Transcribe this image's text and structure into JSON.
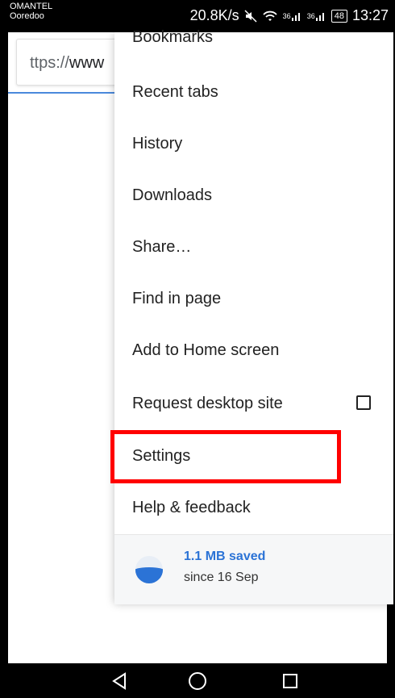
{
  "status_bar": {
    "carrier_line1": "OMANTEL",
    "carrier_line2": "Ooredoo",
    "speed": "20.8K/s",
    "signal_1": "36",
    "signal_2": "36",
    "battery": "48",
    "time": "13:27"
  },
  "url_bar": {
    "prefix": "ttps://",
    "host_fragment": "www"
  },
  "menu": {
    "partial_item": "Bookmarks",
    "items": [
      {
        "label": "Recent tabs"
      },
      {
        "label": "History"
      },
      {
        "label": "Downloads"
      },
      {
        "label": "Share…"
      },
      {
        "label": "Find in page"
      },
      {
        "label": "Add to Home screen"
      },
      {
        "label": "Request desktop site",
        "checked": false
      },
      {
        "label": "Settings",
        "highlighted": true
      },
      {
        "label": "Help & feedback"
      }
    ],
    "data_saver": {
      "title": "1.1 MB saved",
      "subtitle": "since 16 Sep"
    }
  },
  "colors": {
    "accent": "#2b73d6",
    "highlight": "#ff0000"
  },
  "icons": [
    "wifi-icon",
    "signal-icon",
    "battery-icon",
    "checkbox-icon",
    "data-saver-icon",
    "back-icon",
    "home-icon",
    "recents-icon"
  ]
}
